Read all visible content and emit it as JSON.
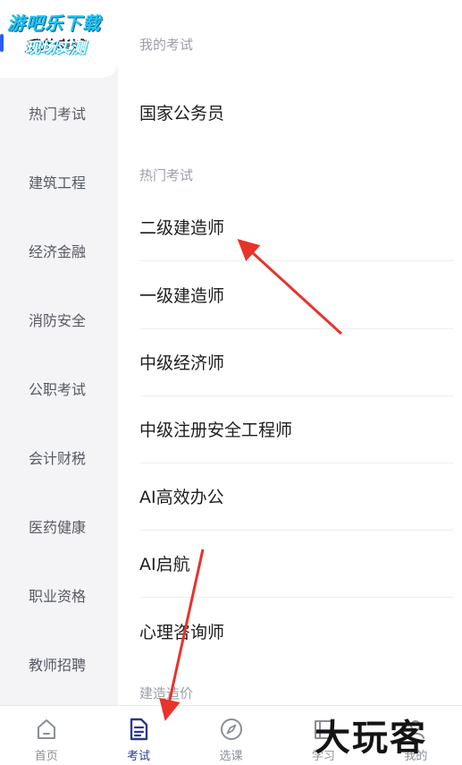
{
  "watermark": {
    "line1": "游吧乐下载",
    "line2": "现场实测"
  },
  "sidebar": {
    "items": [
      {
        "label": "我的考试"
      },
      {
        "label": "热门考试"
      },
      {
        "label": "建筑工程"
      },
      {
        "label": "经济金融"
      },
      {
        "label": "消防安全"
      },
      {
        "label": "公职考试"
      },
      {
        "label": "会计财税"
      },
      {
        "label": "医药健康"
      },
      {
        "label": "职业资格"
      },
      {
        "label": "教师招聘"
      }
    ]
  },
  "content": {
    "sections": [
      {
        "title": "我的考试",
        "items": [
          "国家公务员"
        ]
      },
      {
        "title": "热门考试",
        "items": [
          "二级建造师",
          "一级建造师",
          "中级经济师",
          "中级注册安全工程师",
          "AI高效办公",
          "AI启航",
          "心理咨询师"
        ]
      },
      {
        "title": "建造造价",
        "items": []
      }
    ]
  },
  "tabbar": {
    "tabs": [
      {
        "label": "首页",
        "icon": "home-icon"
      },
      {
        "label": "考试",
        "icon": "document-icon"
      },
      {
        "label": "选课",
        "icon": "compass-icon"
      },
      {
        "label": "学习",
        "icon": "book-icon"
      },
      {
        "label": "我的",
        "icon": "user-icon"
      }
    ]
  },
  "logo": {
    "text": "大玩客"
  },
  "colors": {
    "accent": "#2b5cff",
    "tab_active": "#2a3a8c",
    "arrow": "#e8332a"
  }
}
